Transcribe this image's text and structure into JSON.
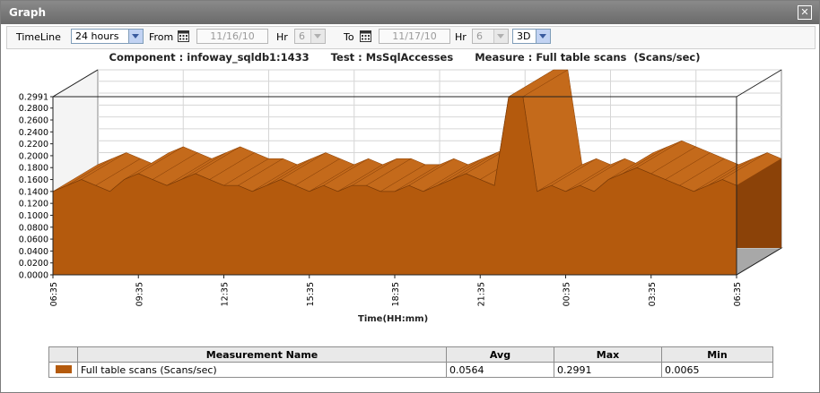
{
  "window": {
    "title": "Graph",
    "close_icon": "close-icon"
  },
  "toolbar": {
    "timeline_label": "TimeLine",
    "timeline_value": "24 hours",
    "from_label": "From",
    "from_date": "11/16/10",
    "from_hr_label": "Hr",
    "from_hr_value": "6",
    "to_label": "To",
    "to_date": "11/17/10",
    "to_hr_label": "Hr",
    "to_hr_value": "6",
    "view_value": "3D",
    "calendar_icon": "calendar-icon"
  },
  "header": {
    "component": "Component : infoway_sqldb1:1433",
    "test": "Test : MsSqlAccesses",
    "measure": "Measure : Full table scans  (Scans/sec)"
  },
  "chart_data": {
    "type": "area",
    "render": "3d",
    "color": "#b45a0d",
    "xlabel": "Time(HH:mm)",
    "ylabel": "",
    "x_ticks": [
      "06:35",
      "09:35",
      "12:35",
      "15:35",
      "18:35",
      "21:35",
      "00:35",
      "03:35",
      "06:35"
    ],
    "y_ticks": [
      "0.0000",
      "0.0200",
      "0.0400",
      "0.0600",
      "0.0800",
      "0.1000",
      "0.1200",
      "0.1400",
      "0.1600",
      "0.1800",
      "0.2000",
      "0.2200",
      "0.2400",
      "0.2600",
      "0.2800",
      "0.2991"
    ],
    "ylim": [
      0,
      0.2991
    ],
    "grid": true,
    "series": [
      {
        "name": "Full table scans (Scans/sec)",
        "x_hours": [
          0,
          0.5,
          1,
          1.5,
          2,
          2.5,
          3,
          3.5,
          4,
          4.5,
          5,
          5.5,
          6,
          6.5,
          7,
          7.5,
          8,
          8.5,
          9,
          9.5,
          10,
          10.5,
          11,
          11.5,
          12,
          12.5,
          13,
          13.5,
          14,
          14.5,
          15,
          15.5,
          16,
          16.5,
          17,
          17.5,
          18,
          18.5,
          19,
          19.5,
          20,
          20.5,
          21,
          21.5,
          22,
          22.5,
          23,
          23.5,
          24
        ],
        "values": [
          0.14,
          0.15,
          0.16,
          0.15,
          0.14,
          0.16,
          0.17,
          0.16,
          0.15,
          0.16,
          0.17,
          0.16,
          0.15,
          0.15,
          0.14,
          0.15,
          0.16,
          0.15,
          0.14,
          0.15,
          0.14,
          0.15,
          0.15,
          0.14,
          0.14,
          0.15,
          0.14,
          0.15,
          0.16,
          0.17,
          0.16,
          0.15,
          0.2991,
          0.2991,
          0.14,
          0.15,
          0.14,
          0.15,
          0.14,
          0.16,
          0.17,
          0.18,
          0.17,
          0.16,
          0.15,
          0.14,
          0.15,
          0.16,
          0.15
        ]
      }
    ]
  },
  "table": {
    "headers": [
      "",
      "Measurement Name",
      "Avg",
      "Max",
      "Min"
    ],
    "rows": [
      {
        "name": "Full table scans (Scans/sec)",
        "avg": "0.0564",
        "max": "0.2991",
        "min": "0.0065"
      }
    ]
  }
}
